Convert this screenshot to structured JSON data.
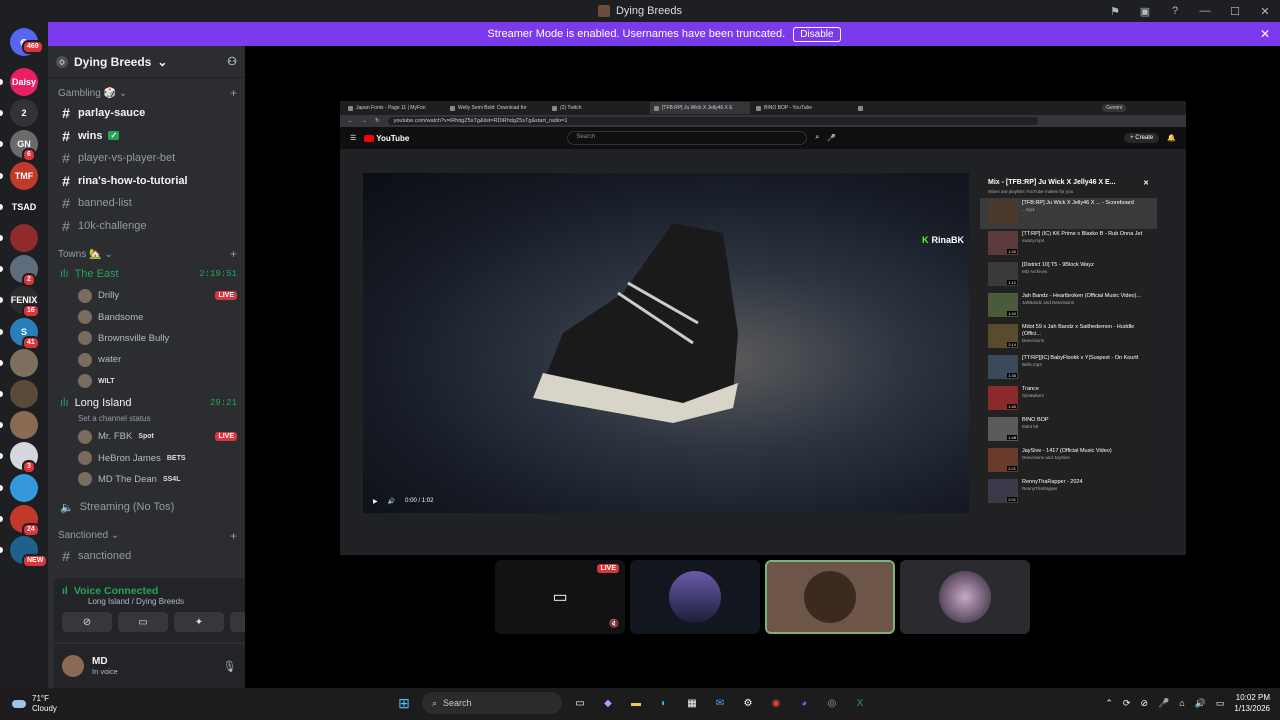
{
  "window": {
    "title": "Dying Breeds"
  },
  "banner": {
    "text": "Streamer Mode is enabled. Usernames have been truncated.",
    "button": "Disable"
  },
  "rail": {
    "home_badge": "469",
    "items": [
      {
        "label": "Daisy",
        "color": "#e91e63"
      },
      {
        "label": "2",
        "color": "#313338"
      },
      {
        "label": "GN",
        "color": "#6b6b6b",
        "badge": "6"
      },
      {
        "label": "TMF",
        "color": "#c0392b"
      },
      {
        "label": "TSAD",
        "color": "#1e1f22"
      },
      {
        "label": "",
        "color": "#8e2b2b"
      },
      {
        "label": "",
        "color": "#5d6d7e",
        "badge": "2"
      },
      {
        "label": "FENIX",
        "color": "#2c2c2c",
        "badge": "16"
      },
      {
        "label": "S",
        "color": "#2980b9",
        "badge": "41"
      },
      {
        "label": "",
        "color": "#7d6e5d"
      },
      {
        "label": "",
        "color": "#5a4a3a"
      },
      {
        "label": "",
        "color": "#8a6a52"
      },
      {
        "label": "",
        "color": "#d5d8dc",
        "badge": "3"
      },
      {
        "label": "",
        "color": "#3498db"
      },
      {
        "label": "",
        "color": "#c0392b",
        "badge": "24"
      },
      {
        "label": "",
        "color": "#1f618d",
        "badge": "NEW"
      }
    ]
  },
  "guild": {
    "name": "Dying Breeds"
  },
  "categories": {
    "gambling": "Gambling",
    "towns": "Towns",
    "sanctioned": "Sanctioned"
  },
  "channels": {
    "gambling": [
      {
        "name": "parlay-sauce",
        "unread": true
      },
      {
        "name": "wins",
        "unread": true,
        "check": "✓"
      },
      {
        "name": "player-vs-player-bet",
        "unread": false
      },
      {
        "name": "rina's-how-to-tutorial",
        "unread": true
      },
      {
        "name": "banned-list",
        "unread": false
      },
      {
        "name": "10k-challenge",
        "unread": false
      }
    ],
    "sanctioned": [
      {
        "name": "sanctioned"
      }
    ]
  },
  "voice": {
    "east": {
      "name": "The East",
      "time": "2:19:51",
      "members": [
        {
          "name": "Drilly",
          "live": "LIVE"
        },
        {
          "name": "Bandsome"
        },
        {
          "name": "Brownsville Bully"
        },
        {
          "name": "water"
        },
        {
          "name": "",
          "tag": "WILT"
        }
      ]
    },
    "long": {
      "name": "Long Island",
      "time": "29:21",
      "status": "Set a channel status",
      "members": [
        {
          "name": "Mr. FBK",
          "tag": "Spot",
          "live": "LIVE"
        },
        {
          "name": "HeBron James",
          "tag": "BETS"
        },
        {
          "name": "MD The Dean",
          "tag": "SS4L"
        }
      ]
    },
    "streaming": {
      "name": "Streaming (No Tos)"
    }
  },
  "voice_panel": {
    "title": "Voice Connected",
    "sub": "Long Island / Dying Breeds"
  },
  "user": {
    "name": "MD",
    "status": "In voice"
  },
  "browser": {
    "tabs": [
      "Japan Fonts - Page 11 | MyFon",
      "Welly Semi Bold: Download for",
      "(2) Twitch",
      "[TFB:RP] Ju Wick X Jelly46 X E",
      "BINO BOP - YouTube",
      ""
    ],
    "gemini": "Gemini",
    "url": "youtube.com/watch?v=iRhdgZ5sTg&list=RDiRhdgZ5sTg&start_radio=1"
  },
  "youtube": {
    "logo": "YouTube",
    "search_placeholder": "Search",
    "create": "+ Create",
    "time": "0:00 / 1:02"
  },
  "overlay": {
    "text": "RinaBK"
  },
  "playlist": {
    "title": "Mix - [TFB:RP] Ju Wick X Jelly46 X E...",
    "sub": "Mixes are playlists YouTube makes for you",
    "items": [
      {
        "title": "[TFB:RP] Ju Wick X Jelly46 X ... - Scoreboard",
        "author": "...mp4",
        "dur": ""
      },
      {
        "title": "[TT:RP] (IC) KK Prime x Blaxko B - Rub Onna Jet",
        "author": "swazy.mp4",
        "dur": "1:30"
      },
      {
        "title": "[District 10] T5 - 9Block Wayz",
        "author": "MD Archives",
        "dur": "1:12"
      },
      {
        "title": "Jah Bandz - Heartbroken (Official Music Video)...",
        "author": "JahBandz and Deevisions",
        "dur": "1:34"
      },
      {
        "title": "Mdot 59 x Jah Bandz x Saithedemon - Huddle (Offici...",
        "author": "Deevisions",
        "dur": "2:14"
      },
      {
        "title": "[TT:RP][IC] BabyFlookk x Y|Suspext - On Kourtt",
        "author": "Bells.mp3",
        "dur": "1:35"
      },
      {
        "title": "Trance",
        "author": "GjHawkem",
        "dur": "1:40"
      },
      {
        "title": "BINO BOP",
        "author": "Mdot 59",
        "dur": "1:48"
      },
      {
        "title": "JaySive - 1417 (Official Music Video)",
        "author": "Deevisions and JaySive",
        "dur": "2:21"
      },
      {
        "title": "RennyThaRapper - 2024",
        "author": "RennyThaRapper",
        "dur": "2:01"
      }
    ]
  },
  "tiles": {
    "live": "LIVE"
  },
  "taskbar": {
    "temp": "71°F",
    "cond": "Cloudy",
    "search": "Search",
    "time": "10:02 PM",
    "date": "1/13/2026"
  }
}
